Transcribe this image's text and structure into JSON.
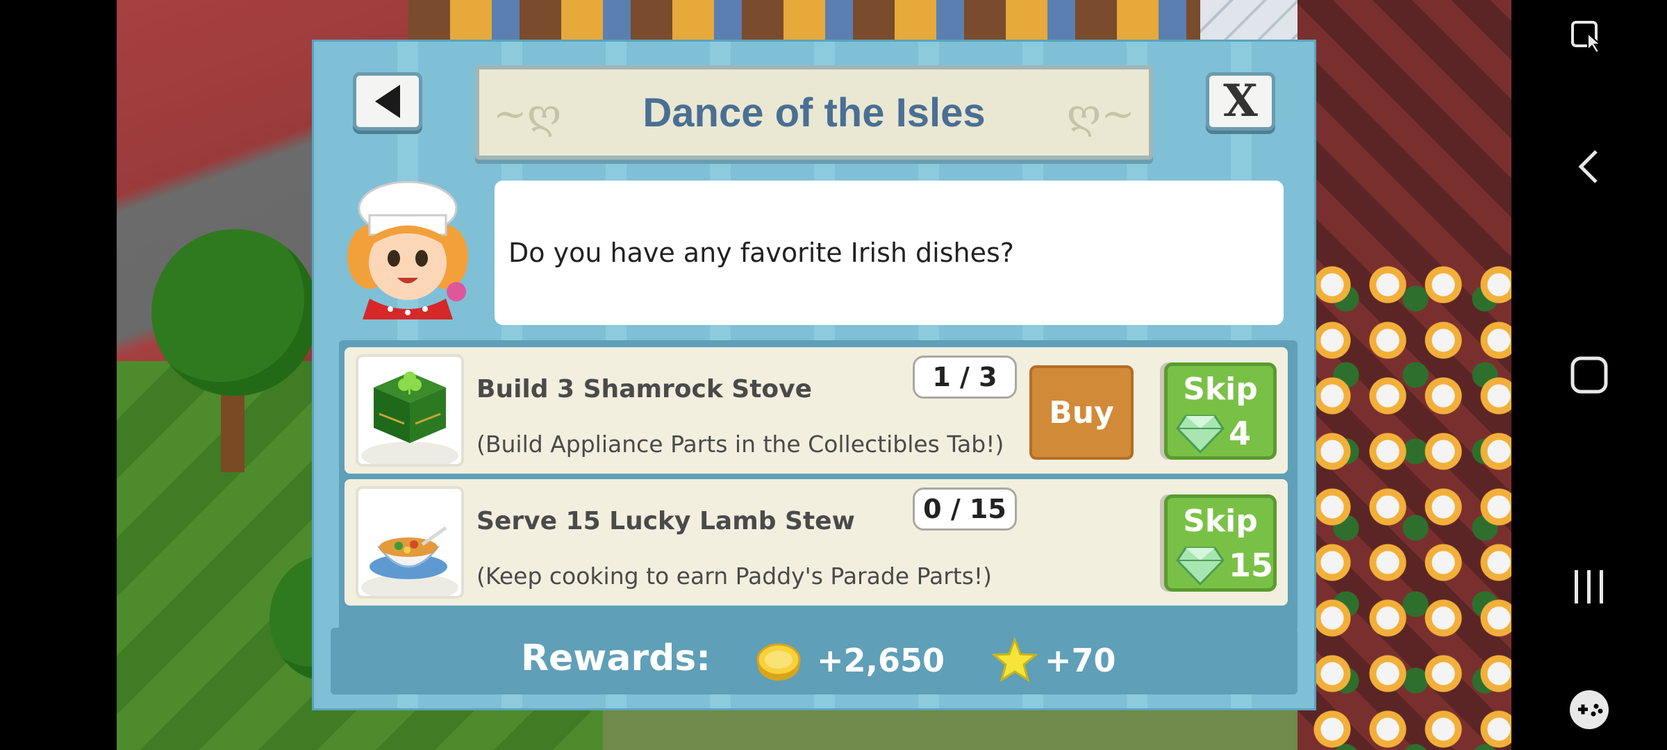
{
  "dialog": {
    "title": "Dance of the Isles",
    "back_icon": "back-arrow-icon",
    "close_label": "X",
    "message": "Do you have any favorite Irish dishes?"
  },
  "tasks": [
    {
      "title": "Build 3 Shamrock Stove",
      "hint": "(Build Appliance Parts in the Collectibles Tab!)",
      "progress": "1 / 3",
      "buy_label": "Buy",
      "skip_label": "Skip",
      "skip_cost": "4",
      "icon": "shamrock-stove-icon"
    },
    {
      "title": "Serve 15 Lucky Lamb Stew",
      "hint": "(Keep cooking to earn Paddy's Parade Parts!)",
      "progress": "0 / 15",
      "skip_label": "Skip",
      "skip_cost": "15",
      "icon": "lamb-stew-icon"
    }
  ],
  "rewards": {
    "label": "Rewards:",
    "coins": "+2,650",
    "xp": "+70"
  },
  "colors": {
    "dialog_bg": "#7fc0d6",
    "title_text": "#4a6f93",
    "buy_button": "#d18a38",
    "skip_button": "#79c146"
  }
}
